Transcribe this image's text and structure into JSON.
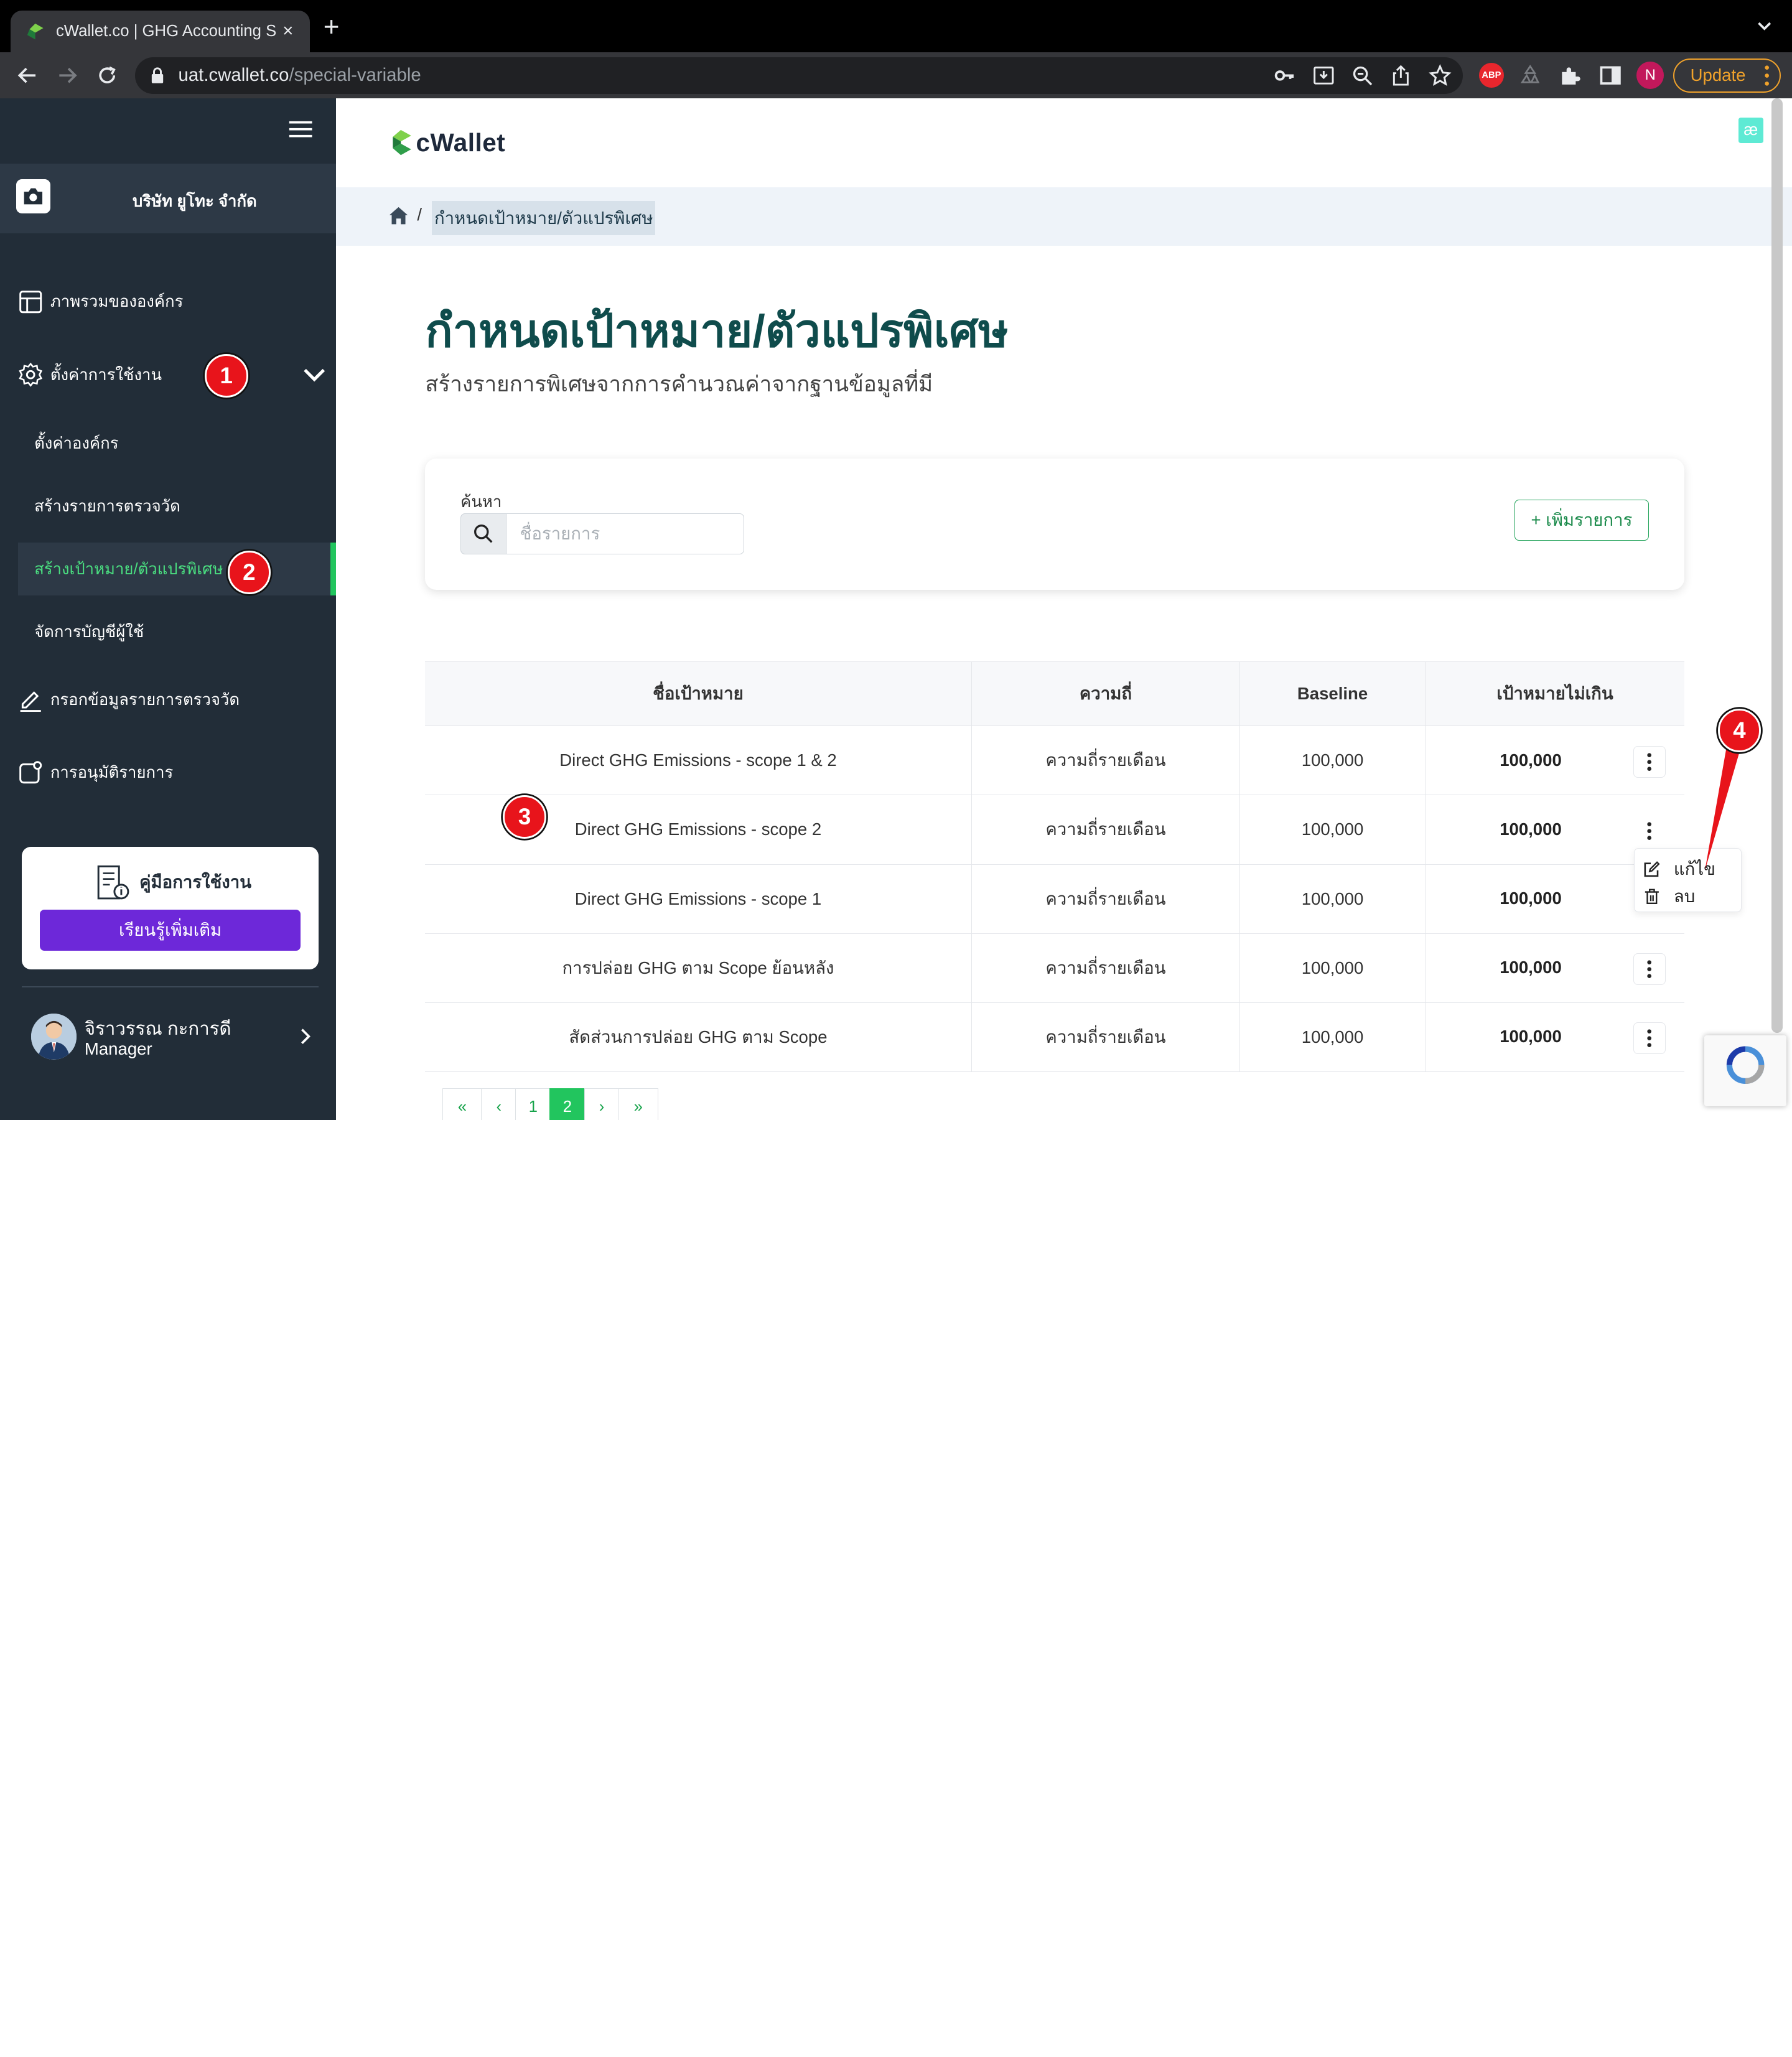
{
  "browser": {
    "tab_title": "cWallet.co | GHG Accounting S",
    "new_tab": "+",
    "close": "×",
    "url_host": "uat.cwallet.co",
    "url_path": "/special-variable",
    "abp": "ABP",
    "profile_initial": "N",
    "update_label": "Update"
  },
  "sidebar": {
    "company": "บริษัท ยูโทะ จำกัด",
    "items": [
      {
        "label": "ภาพรวมขององค์กร"
      },
      {
        "label": "ตั้งค่าการใช้งาน"
      },
      {
        "label": "กรอกข้อมูลรายการตรวจวัด"
      },
      {
        "label": "การอนุมัติรายการ"
      }
    ],
    "subitems": [
      {
        "label": "ตั้งค่าองค์กร"
      },
      {
        "label": "สร้างรายการตรวจวัด"
      },
      {
        "label": "สร้างเป้าหมาย/ตัวแปรพิเศษ"
      },
      {
        "label": "จัดการบัญชีผู้ใช้"
      }
    ],
    "manual_title": "คู่มือการใช้งาน",
    "manual_button": "เรียนรู้เพิ่มเติม",
    "user_name": "จิราวรรณ กะการดี",
    "user_role": "Manager"
  },
  "header": {
    "logo_text": "cWallet",
    "ae_badge": "æ"
  },
  "breadcrumb": {
    "separator": "/",
    "current": "กำหนดเป้าหมาย/ตัวแปรพิเศษ"
  },
  "page": {
    "title": "กำหนดเป้าหมาย/ตัวแปรพิเศษ",
    "subtitle": "สร้างรายการพิเศษจากการคำนวณค่าจากฐานข้อมูลที่มี"
  },
  "search": {
    "label": "ค้นหา",
    "placeholder": "ชื่อรายการ",
    "add_button": "+ เพิ่มรายการ"
  },
  "table": {
    "headers": [
      "ชื่อเป้าหมาย",
      "ความถี่",
      "Baseline",
      "เป้าหมายไม่เกิน"
    ],
    "rows": [
      {
        "name": "Direct GHG Emissions - scope 1 & 2",
        "freq": "ความถี่รายเดือน",
        "baseline": "100,000",
        "target": "100,000"
      },
      {
        "name": "Direct GHG Emissions - scope 2",
        "freq": "ความถี่รายเดือน",
        "baseline": "100,000",
        "target": "100,000"
      },
      {
        "name": "Direct GHG Emissions - scope 1",
        "freq": "ความถี่รายเดือน",
        "baseline": "100,000",
        "target": "100,000"
      },
      {
        "name": "การปล่อย GHG ตาม Scope ย้อนหลัง",
        "freq": "ความถี่รายเดือน",
        "baseline": "100,000",
        "target": "100,000"
      },
      {
        "name": "สัดส่วนการปล่อย GHG ตาม Scope",
        "freq": "ความถี่รายเดือน",
        "baseline": "100,000",
        "target": "100,000"
      }
    ]
  },
  "context_menu": {
    "edit": "แก้ไข",
    "delete": "ลบ"
  },
  "pagination": {
    "first": "«",
    "prev": "‹",
    "pages": [
      "1",
      "2"
    ],
    "next": "›",
    "last": "»"
  },
  "annotations": [
    "1",
    "2",
    "3",
    "4"
  ],
  "colors": {
    "sidebar_bg": "#222d38",
    "accent_green": "#22c55e",
    "title_teal": "#0f4c4c",
    "annotation_red": "#e8141b",
    "manual_button": "#6d28d9"
  }
}
